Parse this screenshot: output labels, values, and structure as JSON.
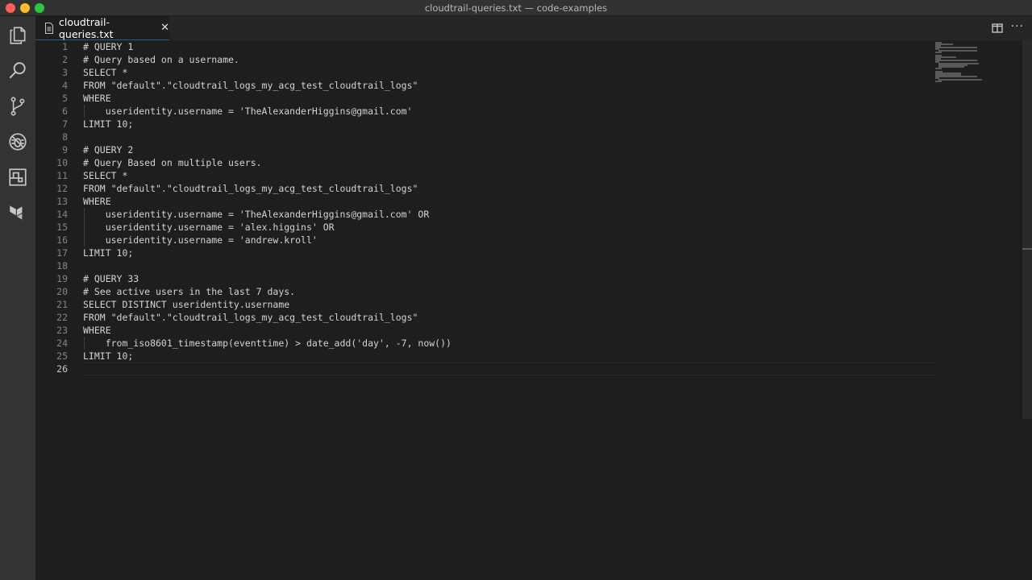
{
  "window": {
    "title": "cloudtrail-queries.txt — code-examples"
  },
  "activity_bar": [
    {
      "name": "explorer-icon"
    },
    {
      "name": "search-icon"
    },
    {
      "name": "source-control-icon"
    },
    {
      "name": "debug-icon"
    },
    {
      "name": "extensions-icon"
    },
    {
      "name": "terraform-icon"
    }
  ],
  "tabs": [
    {
      "label": "cloudtrail-queries.txt",
      "close": "✕",
      "active": true
    }
  ],
  "editor": {
    "active_line": 26,
    "lines": [
      {
        "n": "1",
        "text": "# QUERY 1"
      },
      {
        "n": "2",
        "text": "# Query based on a username."
      },
      {
        "n": "3",
        "text": "SELECT *"
      },
      {
        "n": "4",
        "text": "FROM \"default\".\"cloudtrail_logs_my_acg_test_cloudtrail_logs\""
      },
      {
        "n": "5",
        "text": "WHERE"
      },
      {
        "n": "6",
        "text": "    useridentity.username = 'TheAlexanderHiggins@gmail.com'"
      },
      {
        "n": "7",
        "text": "LIMIT 10;"
      },
      {
        "n": "8",
        "text": ""
      },
      {
        "n": "9",
        "text": "# QUERY 2"
      },
      {
        "n": "10",
        "text": "# Query Based on multiple users."
      },
      {
        "n": "11",
        "text": "SELECT *"
      },
      {
        "n": "12",
        "text": "FROM \"default\".\"cloudtrail_logs_my_acg_test_cloudtrail_logs\""
      },
      {
        "n": "13",
        "text": "WHERE"
      },
      {
        "n": "14",
        "text": "    useridentity.username = 'TheAlexanderHiggins@gmail.com' OR"
      },
      {
        "n": "15",
        "text": "    useridentity.username = 'alex.higgins' OR"
      },
      {
        "n": "16",
        "text": "    useridentity.username = 'andrew.kroll'"
      },
      {
        "n": "17",
        "text": "LIMIT 10;"
      },
      {
        "n": "18",
        "text": ""
      },
      {
        "n": "19",
        "text": "# QUERY 33"
      },
      {
        "n": "20",
        "text": "# See active users in the last 7 days."
      },
      {
        "n": "21",
        "text": "SELECT DISTINCT useridentity.username"
      },
      {
        "n": "22",
        "text": "FROM \"default\".\"cloudtrail_logs_my_acg_test_cloudtrail_logs\""
      },
      {
        "n": "23",
        "text": "WHERE"
      },
      {
        "n": "24",
        "text": "    from_iso8601_timestamp(eventtime) > date_add('day', -7, now())"
      },
      {
        "n": "25",
        "text": "LIMIT 10;"
      },
      {
        "n": "26",
        "text": ""
      }
    ]
  }
}
